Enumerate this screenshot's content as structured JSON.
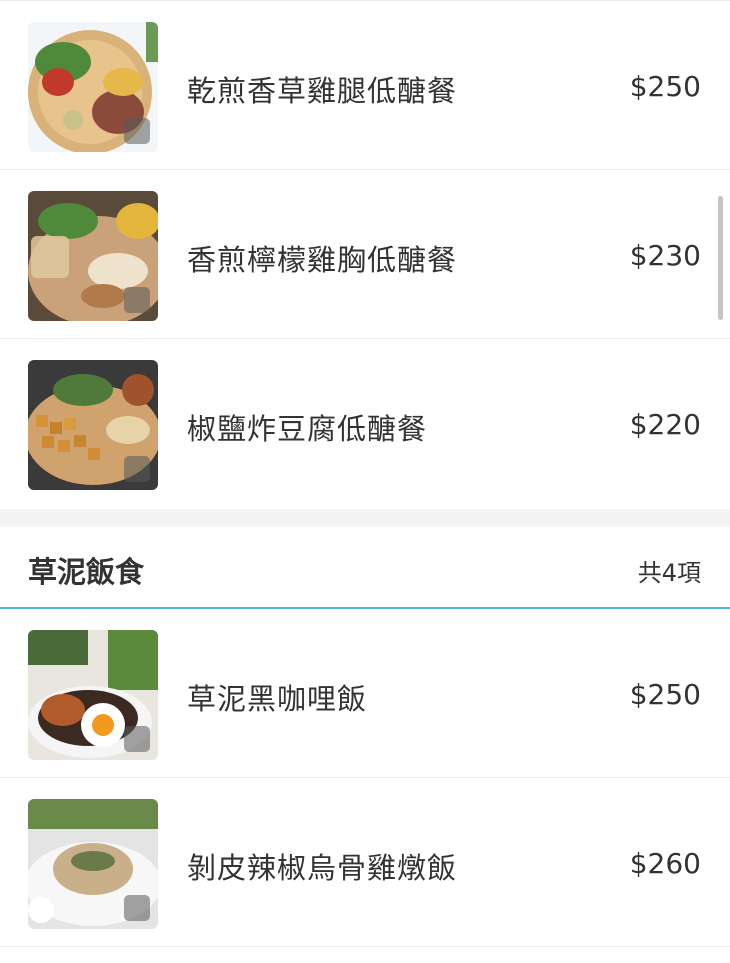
{
  "items_top": [
    {
      "name": "乾煎香草雞腿低醣餐",
      "price": "$250",
      "image": "grilled-chicken-leg-plate"
    },
    {
      "name": "香煎檸檬雞胸低醣餐",
      "price": "$230",
      "image": "lemon-chicken-breast-plate"
    },
    {
      "name": "椒鹽炸豆腐低醣餐",
      "price": "$220",
      "image": "fried-tofu-plate"
    }
  ],
  "category": {
    "title": "草泥飯食",
    "count": "共4項"
  },
  "items_bottom": [
    {
      "name": "草泥黑咖哩飯",
      "price": "$250",
      "image": "black-curry-rice-plate"
    },
    {
      "name": "剝皮辣椒烏骨雞燉飯",
      "price": "$260",
      "image": "chicken-risotto-plate"
    }
  ],
  "colors": {
    "accent": "#4fb7d8",
    "text": "#333333",
    "divider": "#ececec",
    "section_bg": "#f4f4f4"
  }
}
